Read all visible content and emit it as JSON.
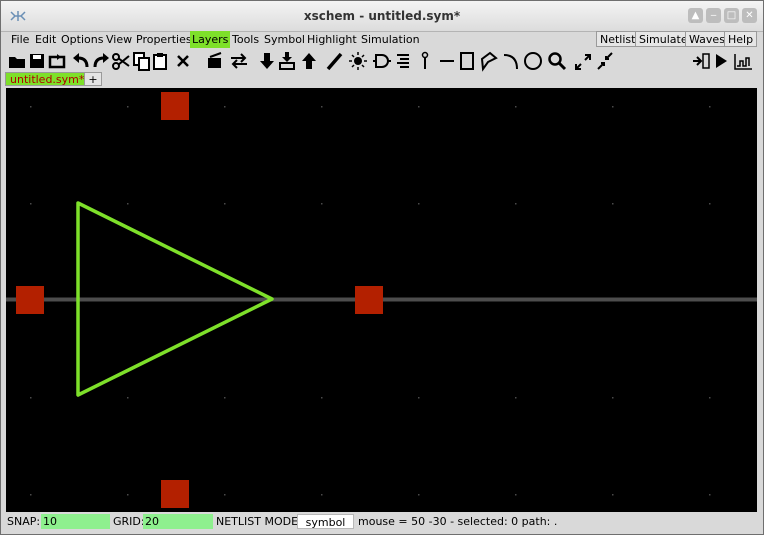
{
  "window": {
    "title": "xschem - untitled.sym*"
  },
  "menu": {
    "items": [
      "File",
      "Edit",
      "Options",
      "View",
      "Properties",
      "Layers",
      "Tools",
      "Symbol",
      "Highlight",
      "Simulation"
    ],
    "active": "Layers",
    "right_buttons": [
      "Netlist",
      "Simulate",
      "Waves",
      "Help"
    ]
  },
  "toolbar": {
    "icons": [
      "open-folder-icon",
      "save-icon",
      "reload-icon",
      "undo-icon",
      "redo-icon",
      "cut-icon",
      "copy-icon",
      "paste-icon",
      "delete-icon",
      "move-icon",
      "swap-icon",
      "push-down-icon",
      "hierarchy-icon",
      "pop-up-icon",
      "wire-pen-icon",
      "highlight-icon",
      "gate-icon",
      "netlist-list-icon",
      "pin-icon",
      "line-icon",
      "rect-icon",
      "polygon-icon",
      "arc-icon",
      "circle-icon",
      "zoom-icon",
      "zoom-in-icon",
      "zoom-out-icon",
      "insert-icon",
      "play-icon",
      "waves-icon"
    ]
  },
  "tabs": [
    {
      "label": "untitled.sym*",
      "active": true
    },
    {
      "label": "+",
      "active": false
    }
  ],
  "canvas": {
    "background": "#000000",
    "symbol_color": "#7ee02a",
    "pin_color": "#b32000",
    "net_color": "#4d4d4d",
    "grid_color": "#4a4a4a"
  },
  "status": {
    "snap_label": "SNAP:",
    "snap_value": "10",
    "grid_label": "GRID:",
    "grid_value": "20",
    "netlist_mode_label": "NETLIST MODE:",
    "netlist_mode_value": "symbol",
    "info": "mouse = 50 -30 - selected: 0 path: ."
  }
}
